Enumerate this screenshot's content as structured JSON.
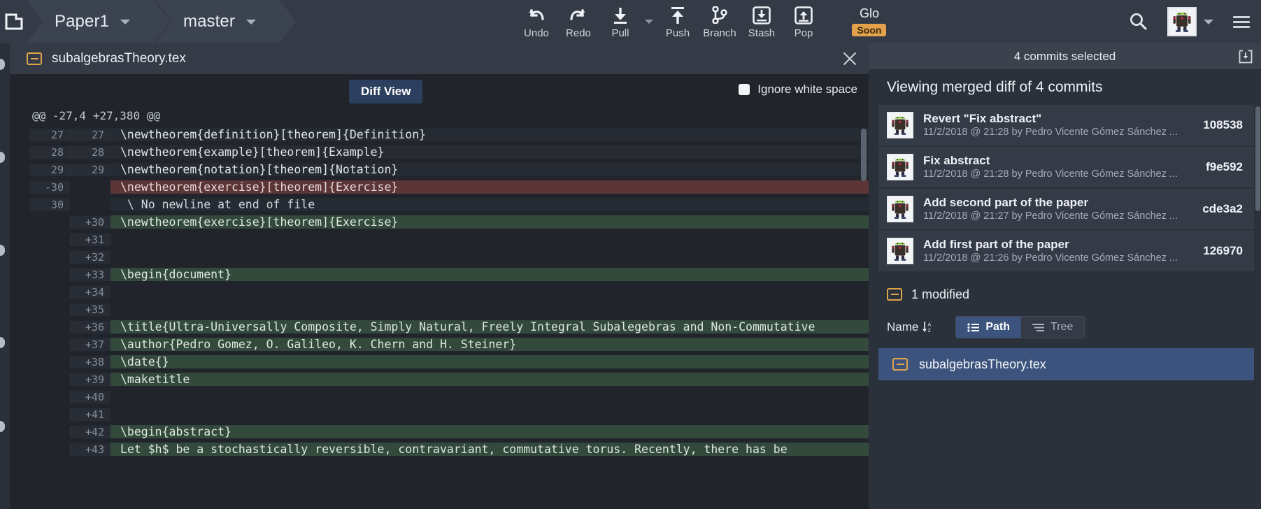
{
  "toolbar": {
    "repo_icon": "repo-folder-icon",
    "breadcrumbs": [
      {
        "label": "Paper1",
        "icon": "chevron-down-icon"
      },
      {
        "label": "master",
        "icon": "chevron-down-icon"
      }
    ],
    "actions": [
      {
        "label": "Undo",
        "icon": "undo-arrow-icon"
      },
      {
        "label": "Redo",
        "icon": "redo-arrow-icon"
      },
      {
        "label": "Pull",
        "icon": "pull-down-arrow-icon"
      },
      {
        "label": "Push",
        "icon": "push-up-arrow-icon"
      },
      {
        "label": "Branch",
        "icon": "branch-fork-icon"
      },
      {
        "label": "Stash",
        "icon": "stash-box-down-icon"
      },
      {
        "label": "Pop",
        "icon": "pop-box-up-icon"
      }
    ],
    "glo": {
      "label": "Glo",
      "badge": "Soon"
    },
    "search_icon": "search-magnifier-icon",
    "avatar_icon": "android-avatar-icon",
    "avatar_caret_icon": "chevron-down-icon",
    "menu_icon": "hamburger-menu-icon"
  },
  "diff_panel": {
    "file_name": "subalgebrasTheory.tex",
    "file_icon": "tex-file-icon",
    "close_icon": "close-x-icon",
    "diff_view_button": "Diff View",
    "ignore_whitespace_label": "Ignore white space",
    "ignore_whitespace_checked": false,
    "hunk_header": "@@ -27,4 +27,380 @@",
    "rows": [
      {
        "type": "ctx",
        "old": "27",
        "new": "27",
        "code": "\\newtheorem{definition}[theorem]{Definition}"
      },
      {
        "type": "ctx",
        "old": "28",
        "new": "28",
        "code": "\\newtheorem{example}[theorem]{Example}"
      },
      {
        "type": "ctx",
        "old": "29",
        "new": "29",
        "code": "\\newtheorem{notation}[theorem]{Notation}"
      },
      {
        "type": "del",
        "old": "-30",
        "new": "",
        "code": "\\newtheorem{exercise}[theorem]{Exercise}"
      },
      {
        "type": "meta",
        "old": "30",
        "new": "",
        "code": " \\ No newline at end of file"
      },
      {
        "type": "add",
        "old": "",
        "new": "+30",
        "code": "\\newtheorem{exercise}[theorem]{Exercise}"
      },
      {
        "type": "add",
        "old": "",
        "new": "+31",
        "code": ""
      },
      {
        "type": "add",
        "old": "",
        "new": "+32",
        "code": ""
      },
      {
        "type": "add",
        "old": "",
        "new": "+33",
        "code": "\\begin{document}"
      },
      {
        "type": "add",
        "old": "",
        "new": "+34",
        "code": ""
      },
      {
        "type": "add",
        "old": "",
        "new": "+35",
        "code": ""
      },
      {
        "type": "add",
        "old": "",
        "new": "+36",
        "code": "\\title{Ultra-Universally Composite, Simply Natural, Freely Integral Subalegebras and Non-Commutative"
      },
      {
        "type": "add",
        "old": "",
        "new": "+37",
        "code": "\\author{Pedro Gomez, O. Galileo, K. Chern and H. Steiner}"
      },
      {
        "type": "add",
        "old": "",
        "new": "+38",
        "code": "\\date{}"
      },
      {
        "type": "add",
        "old": "",
        "new": "+39",
        "code": "\\maketitle"
      },
      {
        "type": "add",
        "old": "",
        "new": "+40",
        "code": ""
      },
      {
        "type": "add",
        "old": "",
        "new": "+41",
        "code": ""
      },
      {
        "type": "add",
        "old": "",
        "new": "+42",
        "code": "\\begin{abstract}"
      },
      {
        "type": "add",
        "old": "",
        "new": "+43",
        "code": "Let $h$ be a stochastically reversible, contravariant, commutative torus. Recently, there has be"
      }
    ]
  },
  "sidebar": {
    "header_title": "4 commits selected",
    "header_icon": "export-diff-icon",
    "subtitle": "Viewing merged diff of 4 commits",
    "commits": [
      {
        "message": "Revert \"Fix abstract\"",
        "meta": "11/2/2018 @ 21:28 by Pedro Vicente Gómez Sánchez ...",
        "sha": "108538",
        "avatar": "android-avatar-icon"
      },
      {
        "message": "Fix abstract",
        "meta": "11/2/2018 @ 21:28 by Pedro Vicente Gómez Sánchez ...",
        "sha": "f9e592",
        "avatar": "android-avatar-icon"
      },
      {
        "message": "Add second part of the paper",
        "meta": "11/2/2018 @ 21:27 by Pedro Vicente Gómez Sánchez ...",
        "sha": "cde3a2",
        "avatar": "android-avatar-icon"
      },
      {
        "message": "Add first part of the paper",
        "meta": "11/2/2018 @ 21:26 by Pedro Vicente Gómez Sánchez ...",
        "sha": "126970",
        "avatar": "android-avatar-icon"
      }
    ],
    "modified_label": "1 modified",
    "modified_icon": "tex-file-icon",
    "sort_label": "Name",
    "sort_icon": "sort-az-descending-icon",
    "view_modes": [
      {
        "label": "Path",
        "icon": "list-lines-icon",
        "active": true
      },
      {
        "label": "Tree",
        "icon": "tree-lines-icon",
        "active": false
      }
    ],
    "files": [
      {
        "name": "subalgebrasTheory.tex",
        "icon": "tex-file-icon",
        "selected": true
      }
    ]
  },
  "colors": {
    "toolbar_bg": "#343a46",
    "panel_bg": "#21252b",
    "sidebar_bg": "#2b313b",
    "accent_blue": "#3c547d",
    "diff_add": "#33493c",
    "diff_del": "#5c3537",
    "badge_orange": "#e2a14a",
    "file_icon_orange": "#e0a44a"
  }
}
